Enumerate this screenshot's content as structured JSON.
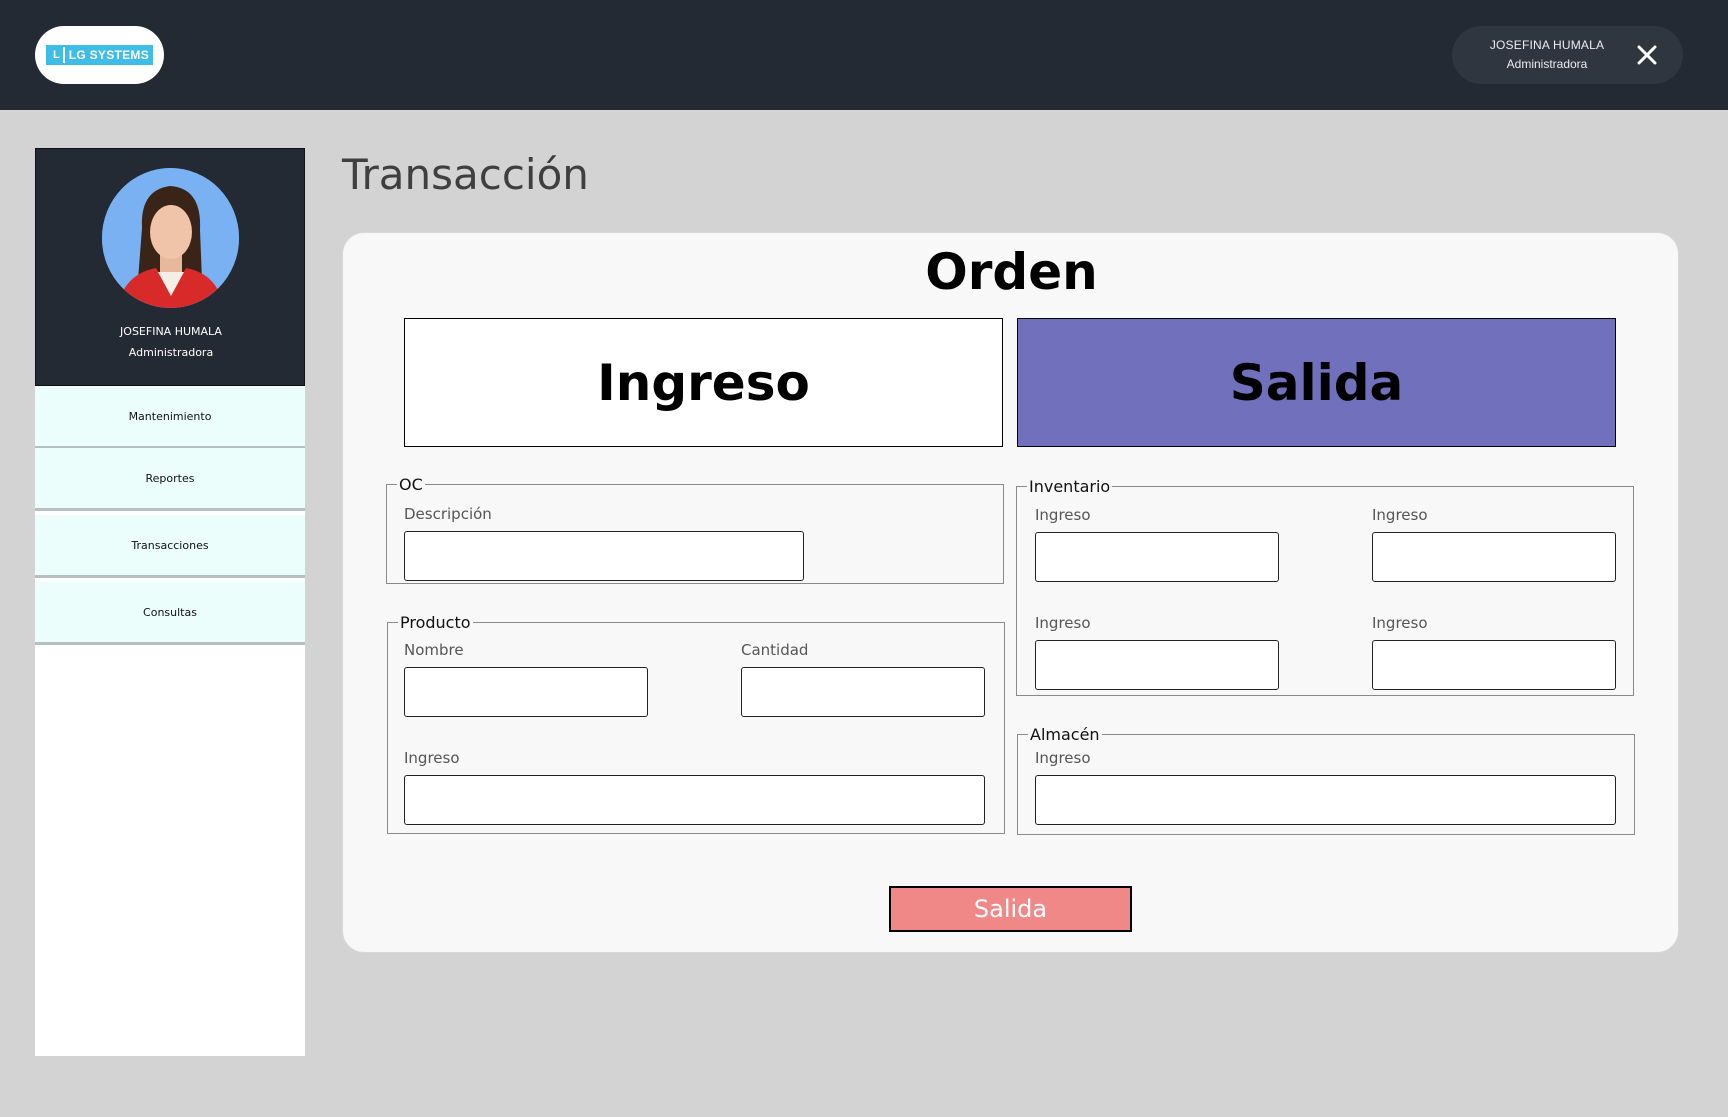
{
  "header": {
    "logo_mark": "L",
    "logo_text": "LG SYSTEMS",
    "user_name": "JOSEFINA HUMALA",
    "user_role": "Administradora"
  },
  "sidebar": {
    "profile_name": "JOSEFINA HUMALA",
    "profile_role": "Administradora",
    "items": [
      {
        "label": "Mantenimiento"
      },
      {
        "label": "Reportes"
      },
      {
        "label": "Transacciones"
      },
      {
        "label": "Consultas"
      }
    ]
  },
  "main": {
    "page_title": "Transacción",
    "card_title": "Orden",
    "toggle_ingreso": "Ingreso",
    "toggle_salida": "Salida",
    "oc": {
      "legend": "OC",
      "descripcion_label": "Descripción",
      "descripcion_value": ""
    },
    "producto": {
      "legend": "Producto",
      "nombre_label": "Nombre",
      "cantidad_label": "Cantidad",
      "ingreso_label": "Ingreso"
    },
    "inventario": {
      "legend": "Inventario",
      "labels": [
        "Ingreso",
        "Ingreso",
        "Ingreso",
        "Ingreso"
      ]
    },
    "almacen": {
      "legend": "Almacén",
      "ingreso_label": "Ingreso"
    },
    "submit_label": "Salida"
  },
  "colors": {
    "topbar": "#232a33",
    "sidebar_item": "#ebfefc",
    "salida_active": "#7070bc",
    "submit": "#f08888",
    "logo_accent": "#3fbde6"
  }
}
